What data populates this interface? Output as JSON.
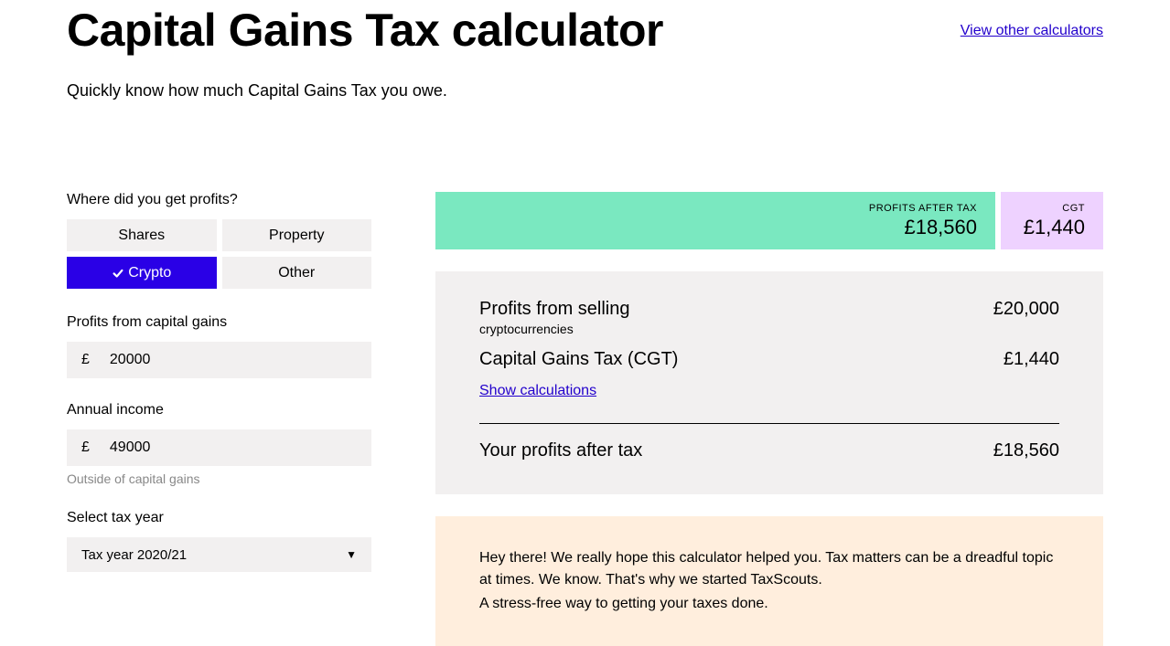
{
  "header": {
    "title": "Capital Gains Tax calculator",
    "other_link": "View other calculators",
    "subtitle": "Quickly know how much Capital Gains Tax you owe."
  },
  "form": {
    "profits_source_label": "Where did you get profits?",
    "options": {
      "shares": "Shares",
      "property": "Property",
      "crypto": "Crypto",
      "other": "Other"
    },
    "selected": "crypto",
    "currency": "£",
    "profits_label": "Profits from capital gains",
    "profits_value": "20000",
    "income_label": "Annual income",
    "income_value": "49000",
    "income_hint": "Outside of capital gains",
    "tax_year_label": "Select tax year",
    "tax_year_value": "Tax year 2020/21"
  },
  "results": {
    "bar_profits_label": "PROFITS AFTER TAX",
    "bar_profits_value": "£18,560",
    "bar_cgt_label": "CGT",
    "bar_cgt_value": "£1,440",
    "row1_label": "Profits from selling",
    "row1_sub": "cryptocurrencies",
    "row1_value": "£20,000",
    "row2_label": "Capital Gains Tax (CGT)",
    "row2_value": "£1,440",
    "show_calc": "Show calculations",
    "row3_label": "Your profits after tax",
    "row3_value": "£18,560"
  },
  "promo": {
    "line1": "Hey there! We really hope this calculator helped you. Tax matters can be a dreadful topic at times. We know. That's why we started TaxScouts.",
    "line2": "A stress-free way to getting your taxes done."
  }
}
